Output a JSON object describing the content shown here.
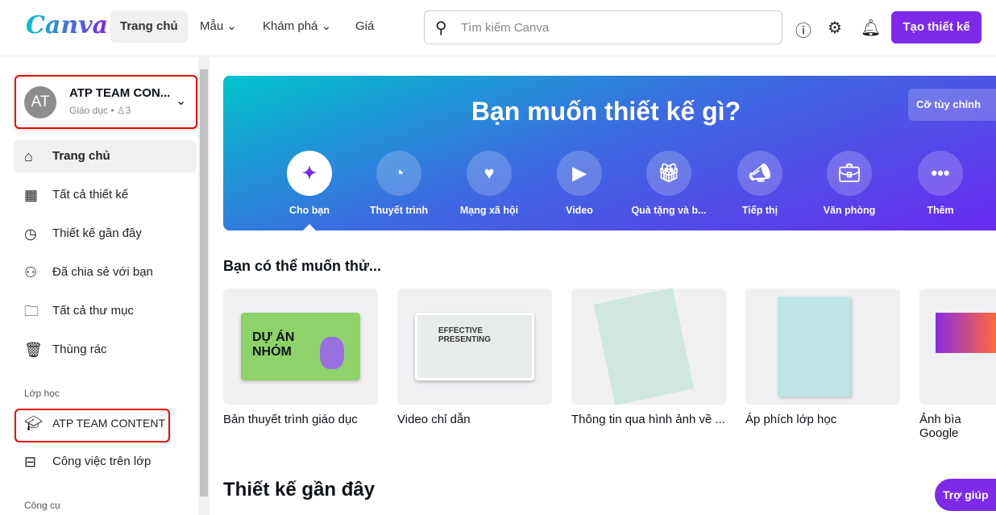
{
  "header": {
    "logo": "Canva",
    "nav": [
      "Trang chủ",
      "Mẫu",
      "Khám phá",
      "Giá"
    ],
    "search_placeholder": "Tìm kiếm Canva",
    "create_label": "Tạo thiết kế"
  },
  "team": {
    "initials": "AT",
    "name": "ATP TEAM CON...",
    "category": "Giáo dục",
    "members": "3"
  },
  "sidebar": {
    "items": [
      "Trang chủ",
      "Tất cả thiết kế",
      "Thiết kế gần đây",
      "Đã chia sẻ với bạn",
      "Tất cả thư mục",
      "Thùng rác"
    ],
    "class_section": "Lớp học",
    "class_items": [
      "ATP TEAM CONTENT",
      "Công việc trên lớp"
    ],
    "tools_section": "Công cụ"
  },
  "banner": {
    "title": "Bạn muốn thiết kế gì?",
    "custom_size": "Cỡ tùy chỉnh",
    "categories": [
      "Cho bạn",
      "Thuyết trình",
      "Mạng xã hội",
      "Video",
      "Quà tặng và b...",
      "Tiếp thị",
      "Văn phòng",
      "Thêm"
    ]
  },
  "suggest": {
    "title": "Bạn có thể muốn thử...",
    "cards": [
      "Bản thuyết trình giáo dục",
      "Video chỉ dẫn",
      "Thông tin qua hình ảnh về ...",
      "Áp phích lớp học",
      "Ảnh bìa Google"
    ],
    "thumb_texts": [
      "DỰ ÁN NHÓM",
      "EFFECTIVE PRESENTING"
    ]
  },
  "recent": {
    "title": "Thiết kế gần đây"
  },
  "help_label": "Trợ giúp",
  "colors": {
    "accent": "#7d2ae8",
    "highlight": "#e00000"
  }
}
